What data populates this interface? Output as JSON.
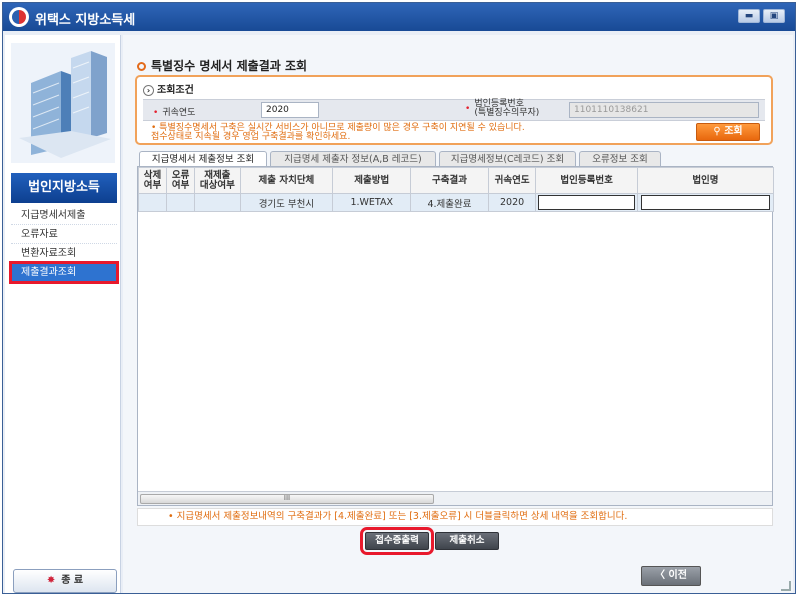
{
  "window": {
    "title": "위택스 지방소득세",
    "minimize_icon": "minimize-icon",
    "maximize_icon": "maximize-icon"
  },
  "sidebar": {
    "title": "법인지방소득",
    "items": [
      {
        "label": "지급명세서제출"
      },
      {
        "label": "오류자료"
      },
      {
        "label": "변환자료조회"
      },
      {
        "label": "제출결과조회"
      }
    ],
    "exit_label": "종 료"
  },
  "main": {
    "page_title": "특별징수 명세서 제출결과 조회",
    "conditions": {
      "title": "조회조건",
      "year_label": "귀속연도",
      "year_value": "2020",
      "biz_label_line1": "법인등록번호",
      "biz_label_line2": "(특별징수의무자)",
      "biz_value": "1101110138621",
      "notice_line1": "• 특별징수명세서 구축은 실시간 서비스가 아니므로 제출량이 많은 경우 구축이 지연될 수 있습니다.",
      "notice_line2": "  접수상태로 지속될 경우 영업 구축결과를 확인하세요.",
      "search_label": "조회"
    },
    "tabs": [
      {
        "label": "지급명세서 제출정보 조회"
      },
      {
        "label": "지급명세 제출자 정보(A,B 레코드)"
      },
      {
        "label": "지급명세정보(C레코드) 조회"
      },
      {
        "label": "오류정보 조회"
      }
    ],
    "table": {
      "headers": [
        {
          "line1": "삭제",
          "line2": "여부"
        },
        {
          "line1": "오류",
          "line2": "여부"
        },
        {
          "line1": "재제출",
          "line2": "대상여부"
        },
        {
          "line1": "제출 자치단체",
          "line2": ""
        },
        {
          "line1": "제출방법",
          "line2": ""
        },
        {
          "line1": "구축결과",
          "line2": ""
        },
        {
          "line1": "귀속연도",
          "line2": ""
        },
        {
          "line1": "법인등록번호",
          "line2": ""
        },
        {
          "line1": "법인명",
          "line2": ""
        }
      ],
      "rows": [
        {
          "del": "",
          "err": "",
          "resubmit": "",
          "region": "경기도 부천시",
          "method": "1.WETAX",
          "result": "4.제출완료",
          "year": "2020"
        }
      ],
      "scroll_label": "III"
    },
    "bottom_notice": "• 지급명세서 제출정보내역의 구축결과가 [4.제출완료] 또는 [3.제출오류] 시 더블클릭하면 상세 내역을 조회합니다.",
    "buttons": {
      "receipt_print": "접수증출력",
      "cancel_submit": "제출취소",
      "prev": "〈 이전"
    }
  }
}
